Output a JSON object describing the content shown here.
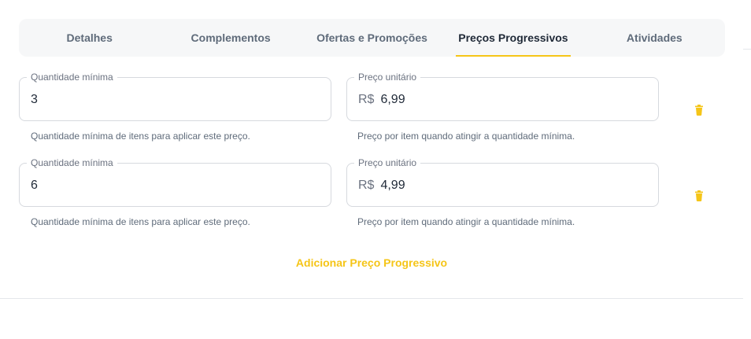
{
  "tabs": [
    {
      "label": "Detalhes"
    },
    {
      "label": "Complementos"
    },
    {
      "label": "Ofertas e Promoções"
    },
    {
      "label": "Preços Progressivos",
      "active": true
    },
    {
      "label": "Atividades"
    }
  ],
  "rows": [
    {
      "quantity_label": "Quantidade mínima",
      "quantity_value": "3",
      "quantity_helper": "Quantidade mínima de itens para aplicar este preço.",
      "price_label": "Preço unitário",
      "currency": "R$",
      "price_value": "6,99",
      "price_helper": "Preço por item quando atingir a quantidade mínima."
    },
    {
      "quantity_label": "Quantidade mínima",
      "quantity_value": "6",
      "quantity_helper": "Quantidade mínima de itens para aplicar este preço.",
      "price_label": "Preço unitário",
      "currency": "R$",
      "price_value": "4,99",
      "price_helper": "Preço por item quando atingir a quantidade mínima."
    }
  ],
  "add_button_label": "Adicionar Preço Progressivo",
  "colors": {
    "accent": "#f5c518"
  },
  "icons": {
    "delete": "trash-icon"
  }
}
